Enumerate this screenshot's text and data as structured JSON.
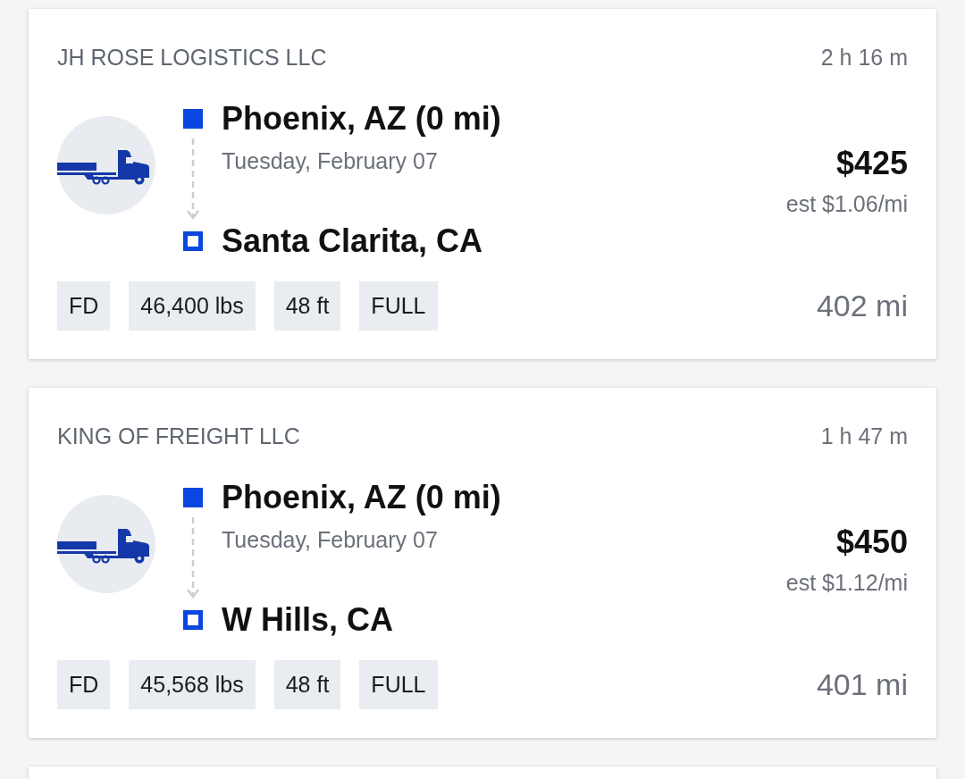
{
  "loads": [
    {
      "company": "JH ROSE LOGISTICS LLC",
      "age": "2 h 16 m",
      "origin": "Phoenix, AZ (0 mi)",
      "date": "Tuesday, February 07",
      "destination": "Santa Clarita, CA",
      "price": "$425",
      "rate": "est $1.06/mi",
      "tags": [
        "FD",
        "46,400 lbs",
        "48 ft",
        "FULL"
      ],
      "distance": "402 mi"
    },
    {
      "company": "KING OF FREIGHT LLC",
      "age": "1 h 47 m",
      "origin": "Phoenix, AZ (0 mi)",
      "date": "Tuesday, February 07",
      "destination": "W Hills, CA",
      "price": "$450",
      "rate": "est $1.12/mi",
      "tags": [
        "FD",
        "45,568 lbs",
        "48 ft",
        "FULL"
      ],
      "distance": "401 mi"
    }
  ]
}
